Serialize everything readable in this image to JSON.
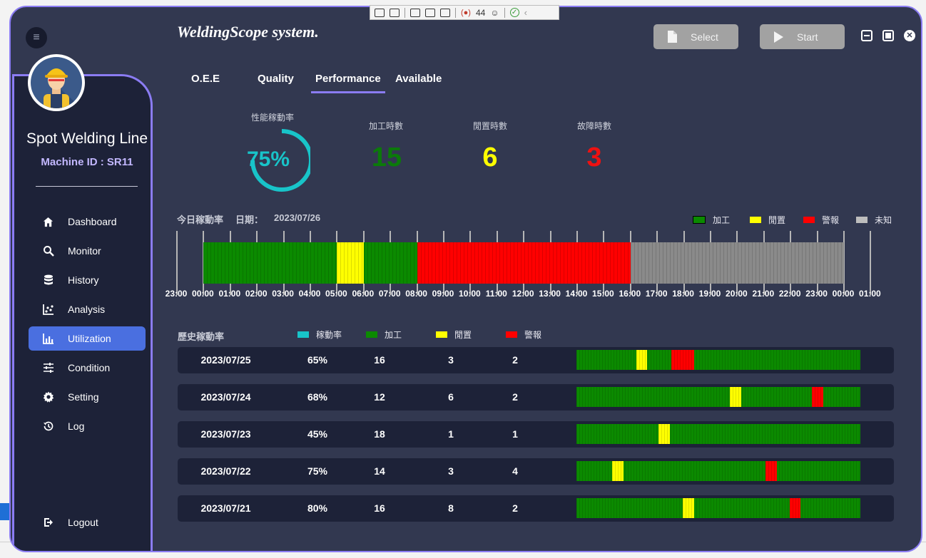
{
  "toolbar": {
    "counter": "44"
  },
  "app": {
    "brand": "WeldingScope system."
  },
  "user": {
    "line_name": "Spot Welding Line",
    "machine_id": "Machine ID : SR11"
  },
  "buttons": {
    "select": "Select",
    "start": "Start"
  },
  "nav": [
    {
      "label": "Dashboard",
      "icon": "home-icon"
    },
    {
      "label": "Monitor",
      "icon": "search-icon"
    },
    {
      "label": "History",
      "icon": "database-icon"
    },
    {
      "label": "Analysis",
      "icon": "scatter-icon"
    },
    {
      "label": "Utilization",
      "icon": "bar-chart-icon",
      "active": true
    },
    {
      "label": "Condition",
      "icon": "sliders-icon"
    },
    {
      "label": "Setting",
      "icon": "gear-icon"
    },
    {
      "label": "Log",
      "icon": "history-icon"
    }
  ],
  "logout": "Logout",
  "tabs": [
    "O.E.E",
    "Quality",
    "Performance",
    "Available"
  ],
  "active_tab": "Performance",
  "kpi": {
    "rate_label": "性能稼動率",
    "rate_value": "75%",
    "rate_fraction": 0.75,
    "process_label": "加工時數",
    "process_value": "15",
    "idle_label": "閒置時數",
    "idle_value": "6",
    "fault_label": "故障時數",
    "fault_value": "3"
  },
  "colors": {
    "process": "#0b8a00",
    "idle": "#ffff00",
    "alarm": "#ff0000",
    "unknown": "#8a8a8a",
    "rate": "#18c4c9",
    "accent": "#8b7cf3",
    "active_nav": "#4a6fe0"
  },
  "today": {
    "title": "今日稼動率",
    "date_label": "日期：",
    "date": "2023/07/26",
    "legend": [
      "加工",
      "閒置",
      "警報",
      "未知"
    ],
    "ticks": [
      "23:00",
      "00:00",
      "01:00",
      "02:00",
      "03:00",
      "04:00",
      "05:00",
      "06:00",
      "07:00",
      "08:00",
      "09:00",
      "10:00",
      "11:00",
      "12:00",
      "13:00",
      "14:00",
      "15:00",
      "16:00",
      "17:00",
      "18:00",
      "19:00",
      "20:00",
      "21:00",
      "22:00",
      "23:00",
      "00:00",
      "01:00"
    ],
    "segments": [
      {
        "state": "process",
        "start": 0,
        "end": 5
      },
      {
        "state": "idle",
        "start": 5,
        "end": 6
      },
      {
        "state": "process",
        "start": 6,
        "end": 8
      },
      {
        "state": "alarm",
        "start": 8,
        "end": 16
      },
      {
        "state": "unknown",
        "start": 16,
        "end": 24
      }
    ]
  },
  "history": {
    "title": "歷史稼動率",
    "legend": [
      "稼動率",
      "加工",
      "閒置",
      "警報"
    ],
    "rows": [
      {
        "date": "2023/07/25",
        "rate": "65%",
        "process": "16",
        "idle": "3",
        "alarm": "2",
        "bar": [
          {
            "state": "idle",
            "start": 0.21,
            "end": 0.25
          },
          {
            "state": "alarm",
            "start": 0.335,
            "end": 0.415
          }
        ]
      },
      {
        "date": "2023/07/24",
        "rate": "68%",
        "process": "12",
        "idle": "6",
        "alarm": "2",
        "bar": [
          {
            "state": "idle",
            "start": 0.54,
            "end": 0.58
          },
          {
            "state": "alarm",
            "start": 0.83,
            "end": 0.87
          }
        ]
      },
      {
        "date": "2023/07/23",
        "rate": "45%",
        "process": "18",
        "idle": "1",
        "alarm": "1",
        "bar": [
          {
            "state": "idle",
            "start": 0.29,
            "end": 0.33
          }
        ]
      },
      {
        "date": "2023/07/22",
        "rate": "75%",
        "process": "14",
        "idle": "3",
        "alarm": "4",
        "bar": [
          {
            "state": "idle",
            "start": 0.125,
            "end": 0.165
          },
          {
            "state": "alarm",
            "start": 0.665,
            "end": 0.705
          }
        ]
      },
      {
        "date": "2023/07/21",
        "rate": "80%",
        "process": "16",
        "idle": "8",
        "alarm": "2",
        "bar": [
          {
            "state": "idle",
            "start": 0.375,
            "end": 0.415
          },
          {
            "state": "alarm",
            "start": 0.75,
            "end": 0.79
          }
        ]
      }
    ]
  }
}
